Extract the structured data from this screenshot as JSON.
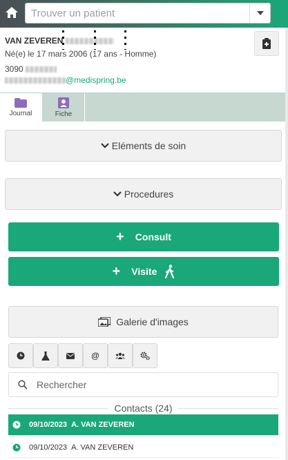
{
  "topbar": {
    "search_placeholder": "Trouver un patient"
  },
  "patient": {
    "name": "VAN ZEVEREN",
    "birth": "Né(e) le 17 mars 2006 (17 ans - Homme)",
    "postcode": "3090",
    "email_domain": "@medispring.be"
  },
  "tabs": [
    {
      "label": "Journal"
    },
    {
      "label": "Fiche"
    }
  ],
  "sections": {
    "elements_label": "Eléments de soin",
    "procedures_label": "Procedures"
  },
  "actions": {
    "consult_label": "Consult",
    "visite_label": "Visite",
    "galerie_label": "Galerie d'images"
  },
  "filters": [
    "clock-icon",
    "flask-icon",
    "envelope-icon",
    "at-icon",
    "users-icon",
    "cogs-icon"
  ],
  "search": {
    "placeholder": "Rechercher"
  },
  "contacts": {
    "header": "Contacts (24)",
    "rows": [
      {
        "date": "09/10/2023",
        "name": "A. VAN ZEVEREN",
        "active": true
      },
      {
        "date": "09/10/2023",
        "name": "A. VAN ZEVEREN",
        "active": false
      }
    ]
  },
  "colors": {
    "accent": "#1aa77a",
    "tab_bg": "#c7d8d0",
    "button_grey": "#f1f1f1"
  }
}
